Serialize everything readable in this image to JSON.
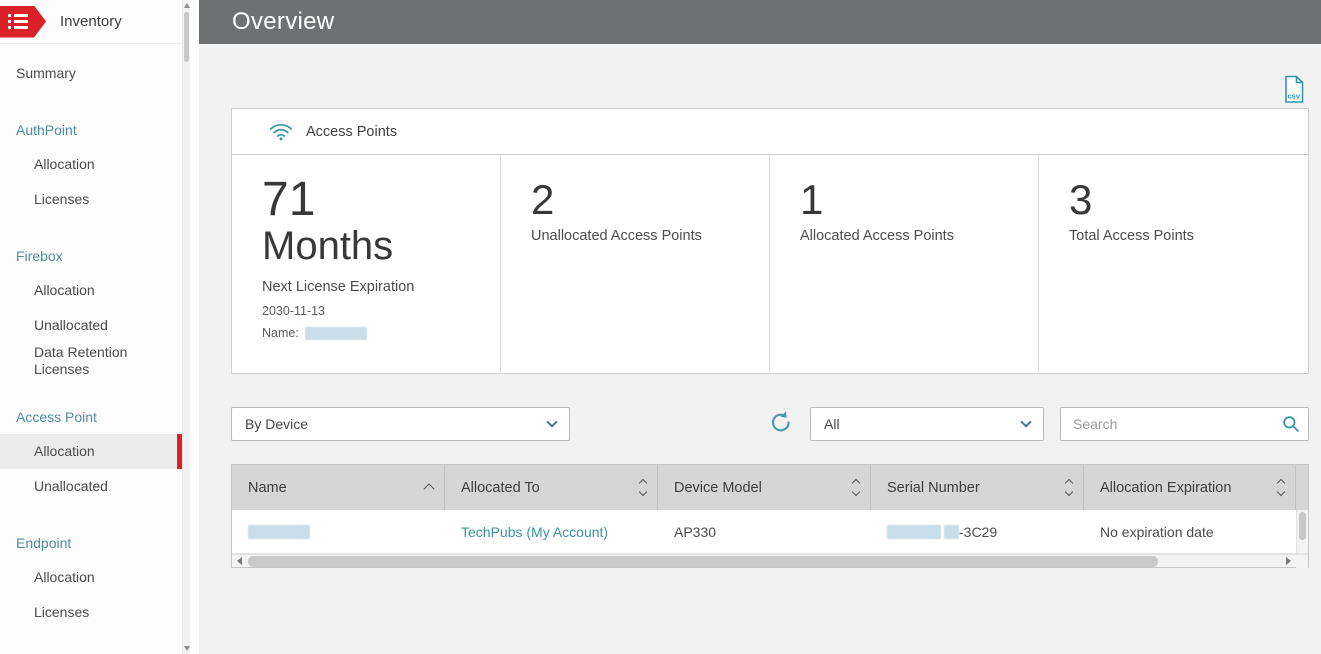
{
  "colors": {
    "brand_red": "#da2128",
    "teal": "#2f97ab",
    "link": "#3993a7"
  },
  "sidebar": {
    "title": "Inventory",
    "summary_label": "Summary",
    "sections": [
      {
        "header": "AuthPoint",
        "items": [
          {
            "label": "Allocation"
          },
          {
            "label": "Licenses"
          }
        ]
      },
      {
        "header": "Firebox",
        "items": [
          {
            "label": "Allocation"
          },
          {
            "label": "Unallocated"
          },
          {
            "label": "Data Retention Licenses"
          }
        ]
      },
      {
        "header": "Access Point",
        "items": [
          {
            "label": "Allocation",
            "selected": true
          },
          {
            "label": "Unallocated"
          }
        ]
      },
      {
        "header": "Endpoint",
        "items": [
          {
            "label": "Allocation"
          },
          {
            "label": "Licenses"
          }
        ]
      }
    ]
  },
  "topbar": {
    "title": "Overview"
  },
  "export_icon": {
    "label": "csv"
  },
  "card": {
    "title": "Access Points",
    "panels": [
      {
        "value": "71",
        "unit": "Months",
        "label": "Next License Expiration",
        "date": "2030-11-13",
        "name_label": "Name:"
      },
      {
        "value": "2",
        "label": "Unallocated Access Points"
      },
      {
        "value": "1",
        "label": "Allocated Access Points"
      },
      {
        "value": "3",
        "label": "Total Access Points"
      }
    ]
  },
  "filters": {
    "group_by_value": "By Device",
    "scope_value": "All",
    "search_placeholder": "Search"
  },
  "table": {
    "columns": [
      {
        "label": "Name",
        "sort": "asc"
      },
      {
        "label": "Allocated To",
        "sort": "both"
      },
      {
        "label": "Device Model",
        "sort": "both"
      },
      {
        "label": "Serial Number",
        "sort": "both"
      },
      {
        "label": "Allocation Expiration",
        "sort": "both"
      }
    ],
    "row": {
      "allocated_to": "TechPubs (My Account)",
      "device_model": "AP330",
      "serial_suffix": "-3C29",
      "expiration": "No expiration date"
    }
  }
}
